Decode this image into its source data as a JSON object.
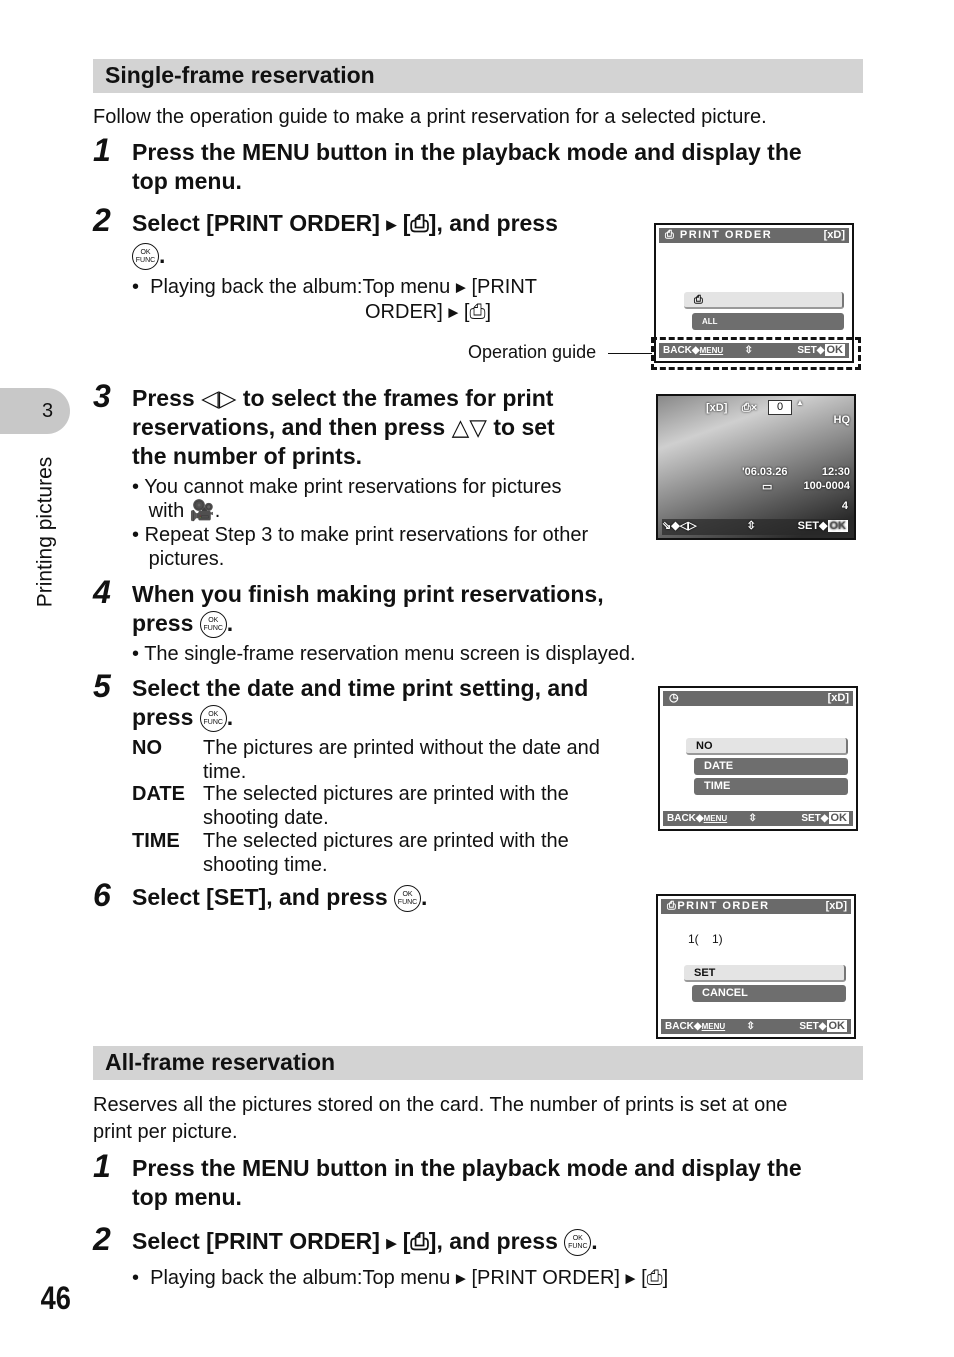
{
  "side_tab": {
    "chapter": "3",
    "title": "Printing pictures"
  },
  "page_number": "46",
  "single": {
    "header": "Single-frame reservation",
    "intro": "Follow the operation guide to make a print reservation for a selected picture.",
    "steps": [
      {
        "n": "1",
        "line1": "Press the MENU button in the playback mode and display the",
        "line2": "top menu."
      },
      {
        "n": "2",
        "text_a": "Select [PRINT ORDER]",
        "text_b": "[",
        "text_c": "], and press",
        "bullet_a": "Playing back the album:Top menu",
        "bullet_b": "[PRINT",
        "bullet_c": "ORDER]",
        "bullet_d": "[",
        "bullet_e": "]"
      },
      {
        "n": "3",
        "a": "Press",
        "b": "to select the frames for print",
        "c": "reservations, and then press",
        "d": "to set",
        "e": "the number of prints.",
        "bullet1a": "You cannot make print reservations for pictures",
        "bullet1b": "with",
        "bullet2a": "Repeat Step 3 to make print reservations for other",
        "bullet2b": "pictures."
      },
      {
        "n": "4",
        "line1": "When you finish making print reservations,",
        "line2": "press",
        "bullet": "The single-frame reservation menu screen is displayed."
      },
      {
        "n": "5",
        "line1": "Select the date and time print setting, and",
        "line2": "press",
        "options": [
          {
            "term": "NO",
            "desc1": "The pictures are printed without the date and",
            "desc2": "time."
          },
          {
            "term": "DATE",
            "desc1": "The selected pictures are printed with the",
            "desc2": "shooting date."
          },
          {
            "term": "TIME",
            "desc1": "The selected pictures are printed with the",
            "desc2": "shooting time."
          }
        ]
      },
      {
        "n": "6",
        "line": "Select [SET], and press"
      }
    ],
    "operation_guide_label": "Operation guide"
  },
  "ok_icon": {
    "top": "OK",
    "bottom": "FUNC"
  },
  "screens": {
    "print_order": {
      "title": "PRINT ORDER",
      "media": "[xD]",
      "back": "BACK",
      "menu": "MENU",
      "set": "SET",
      "ok": "OK",
      "all": "ALL"
    },
    "frame": {
      "media": "[xD]",
      "count": "0",
      "quality": "HQ",
      "date": "'06.03.26",
      "time": "12:30",
      "file": "100-0004",
      "frame_no": "4",
      "set": "SET",
      "ok": "OK"
    },
    "datetime": {
      "media": "[xD]",
      "options": [
        "NO",
        "DATE",
        "TIME"
      ],
      "selected": "NO",
      "back": "BACK",
      "menu": "MENU",
      "set": "SET",
      "ok": "OK"
    },
    "confirm": {
      "title": "PRINT ORDER",
      "media": "[xD]",
      "summary": "1(    1)",
      "options": [
        "SET",
        "CANCEL"
      ],
      "selected": "SET",
      "back": "BACK",
      "menu": "MENU",
      "set": "SET",
      "ok": "OK"
    }
  },
  "all": {
    "header": "All-frame reservation",
    "intro1": "Reserves all the pictures stored on the card. The number of prints is set at one",
    "intro2": "print per picture.",
    "steps": [
      {
        "n": "1",
        "line1": "Press the MENU button in the playback mode and display the",
        "line2": "top menu."
      },
      {
        "n": "2",
        "a": "Select [PRINT ORDER]",
        "b": "[",
        "c": "], and press",
        "bullet_a": "Playing back the album:Top menu",
        "bullet_b": "[PRINT ORDER]",
        "bullet_c": "[",
        "bullet_d": "]"
      }
    ]
  }
}
